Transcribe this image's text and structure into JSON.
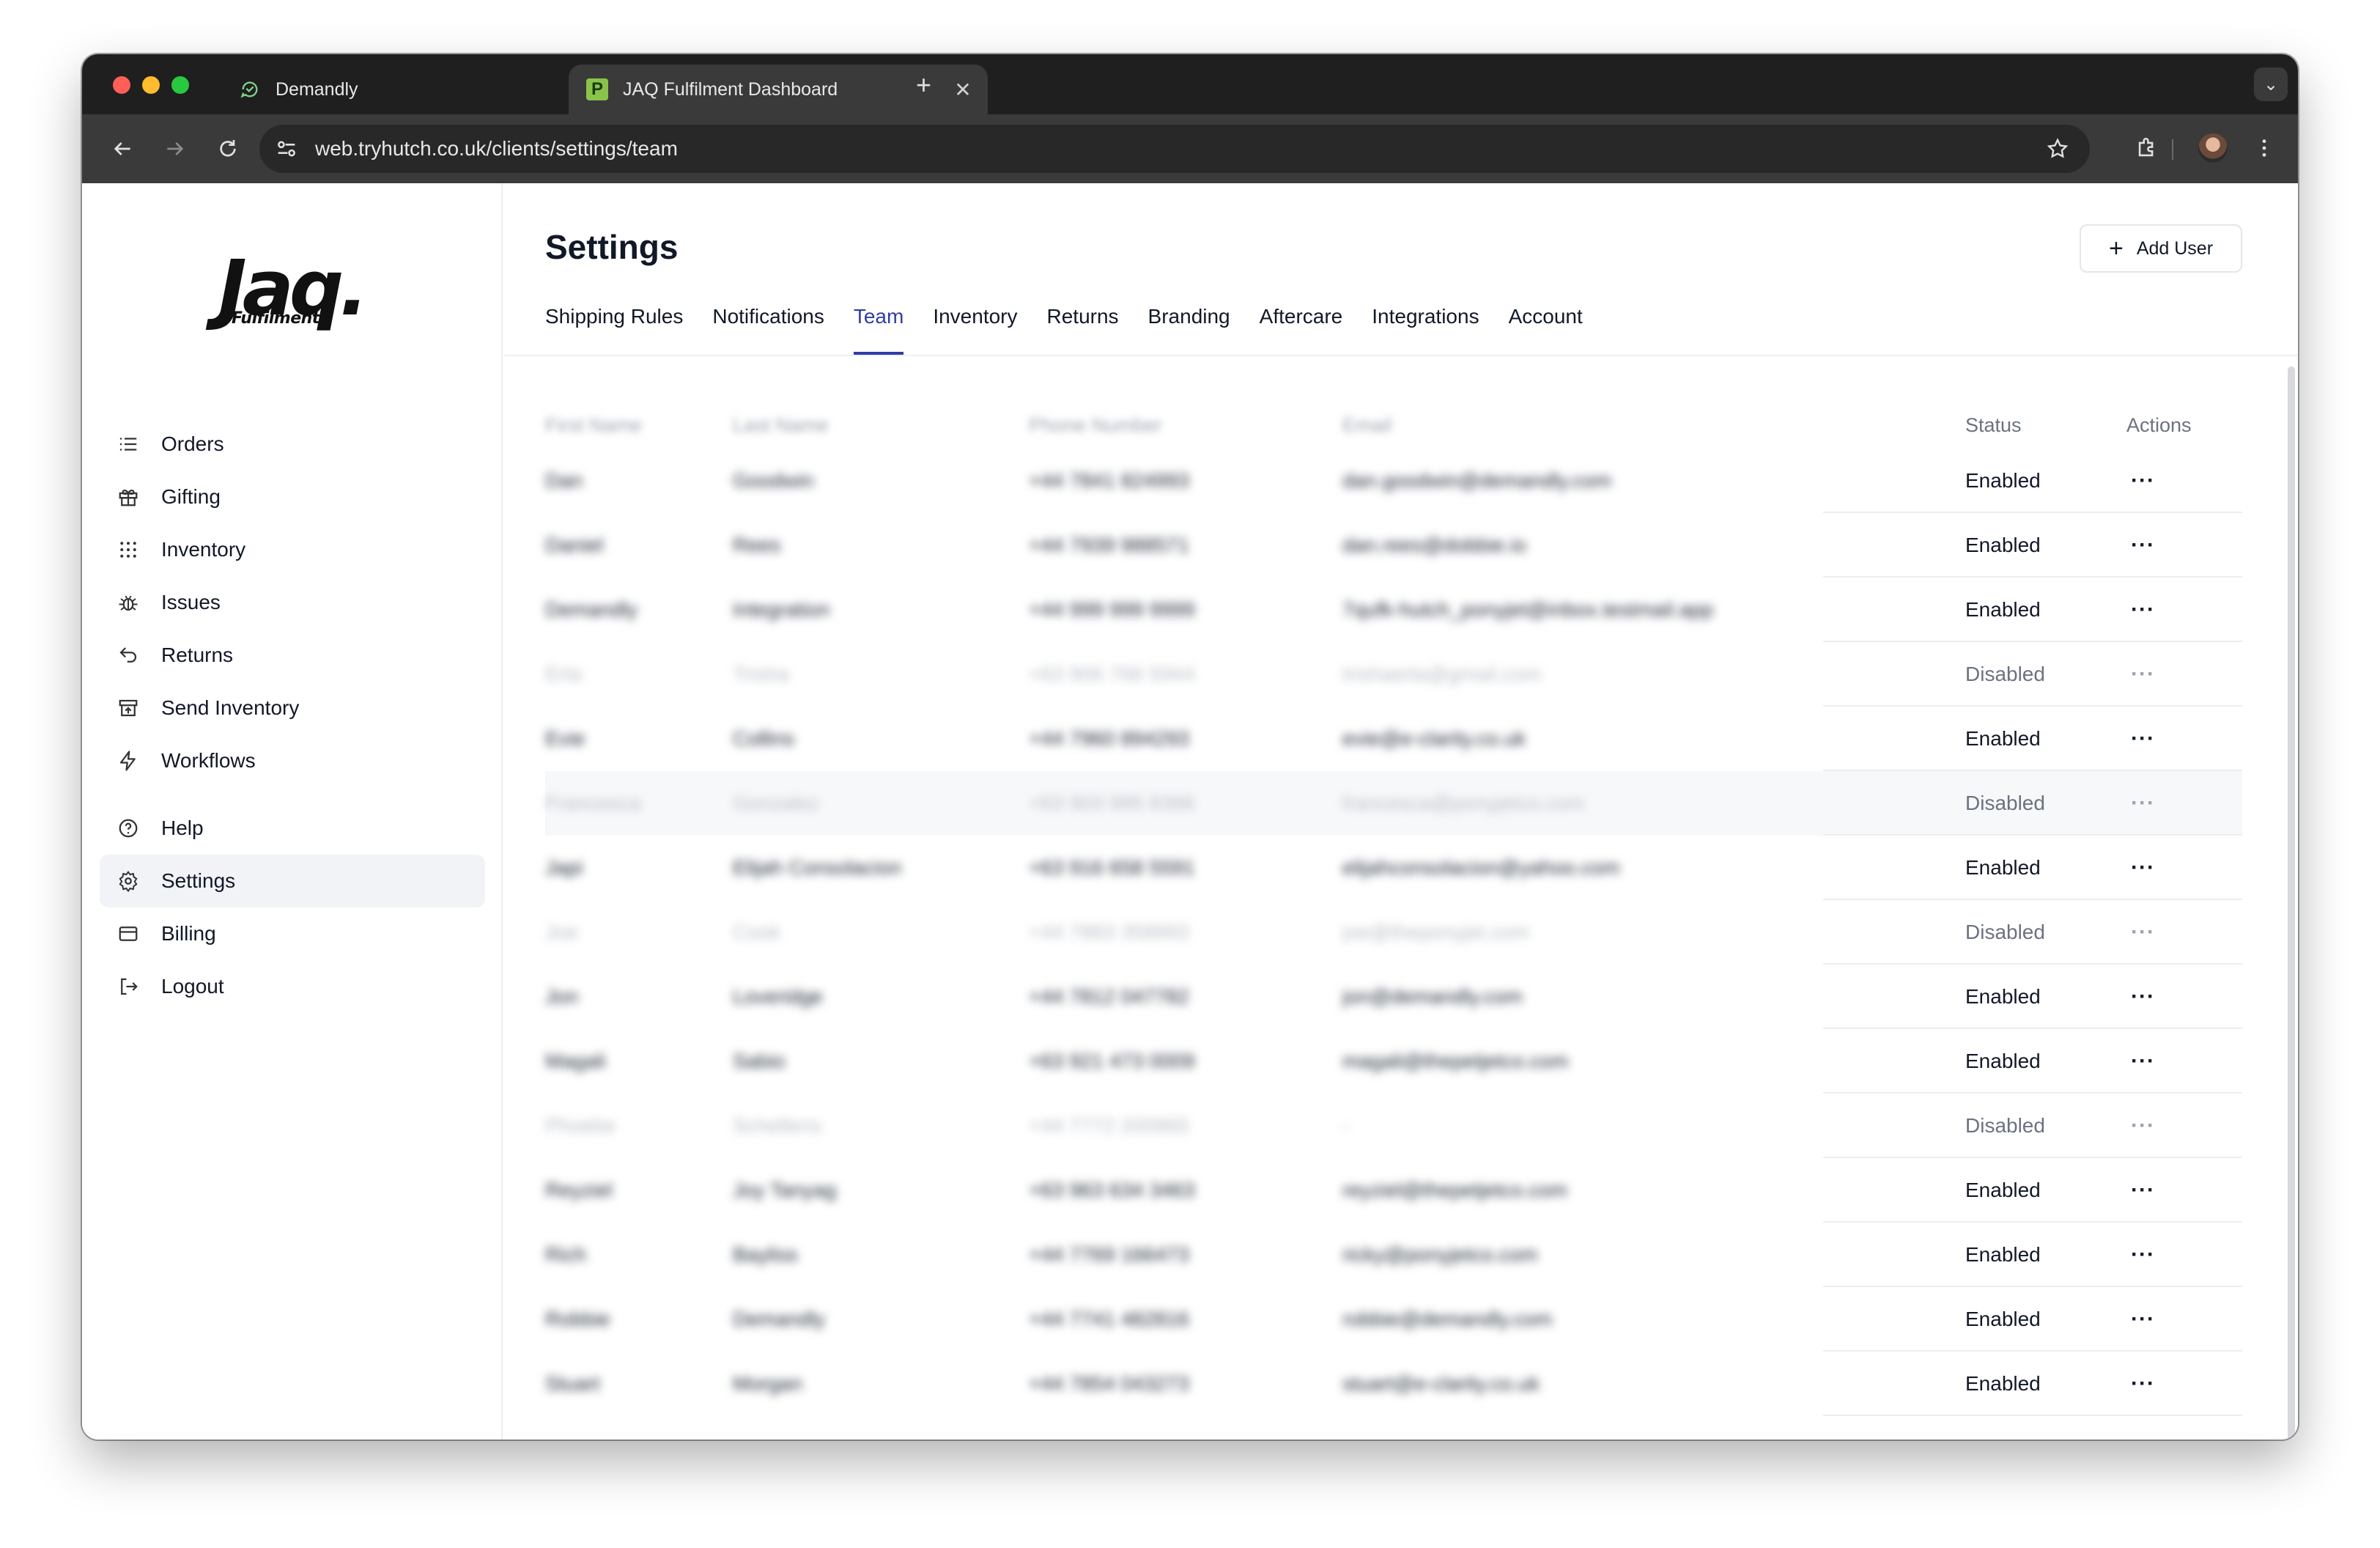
{
  "browser": {
    "tabs": [
      {
        "title": "Demandly",
        "favicon": "demandly-icon"
      },
      {
        "title": "JAQ Fulfilment Dashboard",
        "favicon": "P"
      }
    ],
    "url": "web.tryhutch.co.uk/clients/settings/team"
  },
  "sidebar": {
    "logo_main": "Jaq.",
    "logo_sub": "Fulfilment",
    "items": [
      {
        "label": "Orders",
        "icon": "list-icon"
      },
      {
        "label": "Gifting",
        "icon": "gift-icon"
      },
      {
        "label": "Inventory",
        "icon": "grid-icon"
      },
      {
        "label": "Issues",
        "icon": "bug-icon"
      },
      {
        "label": "Returns",
        "icon": "return-icon"
      },
      {
        "label": "Send Inventory",
        "icon": "warehouse-icon"
      },
      {
        "label": "Workflows",
        "icon": "bolt-icon"
      }
    ],
    "bottom_items": [
      {
        "label": "Help",
        "icon": "help-icon"
      },
      {
        "label": "Settings",
        "icon": "gear-icon",
        "active": true
      },
      {
        "label": "Billing",
        "icon": "card-icon"
      },
      {
        "label": "Logout",
        "icon": "logout-icon"
      }
    ]
  },
  "main": {
    "title": "Settings",
    "add_user_label": "Add User",
    "tabs": [
      "Shipping Rules",
      "Notifications",
      "Team",
      "Inventory",
      "Returns",
      "Branding",
      "Aftercare",
      "Integrations",
      "Account"
    ],
    "active_tab": "Team",
    "table": {
      "headers": [
        "First Name",
        "Last Name",
        "Phone Number",
        "Email",
        "Status",
        "Actions"
      ],
      "rows": [
        {
          "first": "Dan",
          "last": "Goodwin",
          "phone": "+44 7841 824993",
          "email": "dan.goodwin@demandly.com",
          "status": "Enabled"
        },
        {
          "first": "Daniel",
          "last": "Rees",
          "phone": "+44 7939 988571",
          "email": "dan.rees@dobbie.io",
          "status": "Enabled"
        },
        {
          "first": "Demandly",
          "last": "Integration",
          "phone": "+44 999 999 9999",
          "email": "7qufk-hutch_ponyjet@inbox.testmail.app",
          "status": "Enabled"
        },
        {
          "first": "Erla",
          "last": "Trisha",
          "phone": "+63 906 766 5944",
          "email": "trishaerla@gmail.com",
          "status": "Disabled"
        },
        {
          "first": "Evie",
          "last": "Collins",
          "phone": "+44 7960 894293",
          "email": "evie@e-clarity.co.uk",
          "status": "Enabled"
        },
        {
          "first": "Francesca",
          "last": "Gonzalez",
          "phone": "+63 903 995 8396",
          "email": "francesca@ponyjetco.com",
          "status": "Disabled"
        },
        {
          "first": "Japi",
          "last": "Elijah Consolacion",
          "phone": "+63 916 658 5591",
          "email": "elijahconsolacion@yahoo.com",
          "status": "Enabled"
        },
        {
          "first": "Joe",
          "last": "Cook",
          "phone": "+44 7883 358993",
          "email": "joe@theponyjet.com",
          "status": "Disabled"
        },
        {
          "first": "Jon",
          "last": "Loveridge",
          "phone": "+44 7812 047782",
          "email": "jon@demandly.com",
          "status": "Enabled"
        },
        {
          "first": "Magali",
          "last": "Sabio",
          "phone": "+63 921 473 0009",
          "email": "magali@thepetjetco.com",
          "status": "Enabled"
        },
        {
          "first": "Phoebe",
          "last": "Schellens",
          "phone": "+44 7772 200965",
          "email": "-",
          "status": "Disabled"
        },
        {
          "first": "Reyziel",
          "last": "Joy Tanyag",
          "phone": "+63 963 634 3463",
          "email": "reyziel@thepetjetco.com",
          "status": "Enabled"
        },
        {
          "first": "Rich",
          "last": "Bayliss",
          "phone": "+44 7769 166473",
          "email": "ricky@ponyjetco.com",
          "status": "Enabled"
        },
        {
          "first": "Robbie",
          "last": "Demandly",
          "phone": "+44 7741 482816",
          "email": "robbie@demandly.com",
          "status": "Enabled"
        },
        {
          "first": "Stuart",
          "last": "Morgan",
          "phone": "+44 7854 043273",
          "email": "stuart@e-clarity.co.uk",
          "status": "Enabled"
        }
      ],
      "actions_glyph": "···"
    }
  },
  "colors": {
    "accent": "#2f3ea8",
    "active_nav_bg": "#f1f3f6",
    "chrome_dark": "#1f1f1f",
    "chrome_toolbar": "#3a3a3a"
  }
}
